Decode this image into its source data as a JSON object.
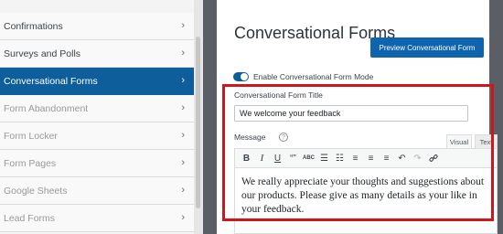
{
  "sidebar": {
    "items": [
      {
        "label": "Confirmations",
        "state": "dark"
      },
      {
        "label": "Surveys and Polls",
        "state": "dark"
      },
      {
        "label": "Conversational Forms",
        "state": "active"
      },
      {
        "label": "Form Abandonment",
        "state": "muted"
      },
      {
        "label": "Form Locker",
        "state": "muted"
      },
      {
        "label": "Form Pages",
        "state": "muted"
      },
      {
        "label": "Google Sheets",
        "state": "muted"
      },
      {
        "label": "Lead Forms",
        "state": "muted"
      }
    ],
    "chevron": "›"
  },
  "main": {
    "title": "Conversational Forms",
    "preview_button": "Preview Conversational Form",
    "toggle_label": "Enable Conversational Form Mode",
    "toggle_on": true,
    "form_title_label": "Conversational Form Title",
    "form_title_value": "We welcome your feedback",
    "message_label": "Message",
    "help_icon": "?",
    "tabs": {
      "visual": "Visual",
      "text": "Text"
    },
    "toolbar": {
      "bold": "B",
      "italic": "I",
      "underline": "U",
      "blockquote": "“”",
      "strike": "ABC",
      "bullets": "☰",
      "numbered": "☷",
      "align_left": "≡",
      "align_center": "≡",
      "align_right": "≡",
      "undo": "↶",
      "redo": "↷",
      "link": "🔗"
    },
    "message_text": "We really appreciate your thoughts and suggestions about our products. Please give as many details as your like in your feedback."
  },
  "colors": {
    "accent": "#0e5e9c",
    "highlight": "#d0161d",
    "canvas_bg": "#5b5e64"
  }
}
